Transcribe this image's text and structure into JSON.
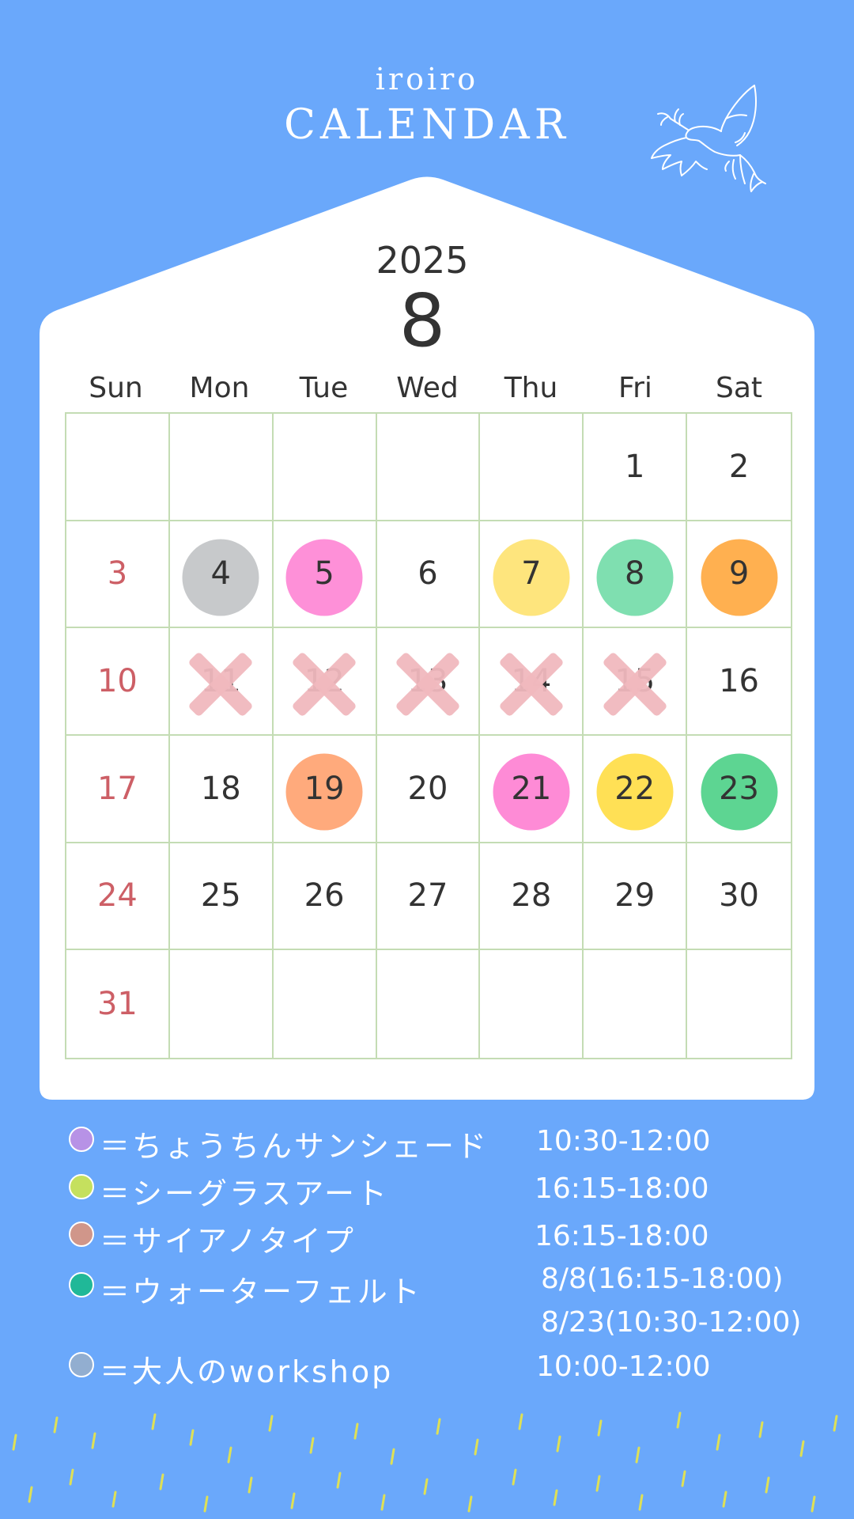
{
  "header": {
    "subtitle": "iroiro",
    "title": "CALENDAR"
  },
  "calendar": {
    "year": "2025",
    "month": "8",
    "weekdays": [
      "Sun",
      "Mon",
      "Tue",
      "Wed",
      "Thu",
      "Fri",
      "Sat"
    ],
    "weeks": [
      [
        "",
        "",
        "",
        "",
        "",
        "1",
        "2"
      ],
      [
        "3",
        "4",
        "5",
        "6",
        "7",
        "8",
        "9"
      ],
      [
        "10",
        "11",
        "12",
        "13",
        "14",
        "15",
        "16"
      ],
      [
        "17",
        "18",
        "19",
        "20",
        "21",
        "22",
        "23"
      ],
      [
        "24",
        "25",
        "26",
        "27",
        "28",
        "29",
        "30"
      ],
      [
        "31",
        "",
        "",
        "",
        "",
        "",
        ""
      ]
    ],
    "marked_days": [
      {
        "day": "4",
        "color": "#c7c9cb"
      },
      {
        "day": "5",
        "color": "#fe90d8"
      },
      {
        "day": "7",
        "color": "#fee57d"
      },
      {
        "day": "8",
        "color": "#7fdfb0"
      },
      {
        "day": "9",
        "color": "#ffb050"
      },
      {
        "day": "19",
        "color": "#ffaa7c"
      },
      {
        "day": "21",
        "color": "#fe8bd6"
      },
      {
        "day": "22",
        "color": "#ffe055"
      },
      {
        "day": "23",
        "color": "#5dd592"
      }
    ],
    "crossed_days": [
      "11",
      "12",
      "13",
      "14",
      "15"
    ],
    "colors": {
      "sunday_text": "#cd5f66",
      "text": "#333333",
      "grid_line": "#c4dcb4",
      "cross": "#f0b8be"
    }
  },
  "legend": [
    {
      "label": "＝ちょうちんサンシェード",
      "time": "10:30-12:00",
      "color": "#b792e6"
    },
    {
      "label": "＝シーグラスアート",
      "time": "16:15-18:00",
      "color": "#c5e05e"
    },
    {
      "label": "＝サイアノタイプ",
      "time": "16:15-18:00",
      "color": "#d0968a"
    },
    {
      "label": "＝ウォーターフェルト",
      "time": "8/8(16:15-18:00)",
      "time2": "8/23(10:30-12:00)",
      "color": "#20b898"
    },
    {
      "label": "＝大人のworkshop",
      "time": "10:00-12:00",
      "color": "#92aed0"
    }
  ],
  "theme": {
    "background": "#6aa8fb",
    "card": "#ffffff",
    "rain": "#f3ea3a"
  }
}
